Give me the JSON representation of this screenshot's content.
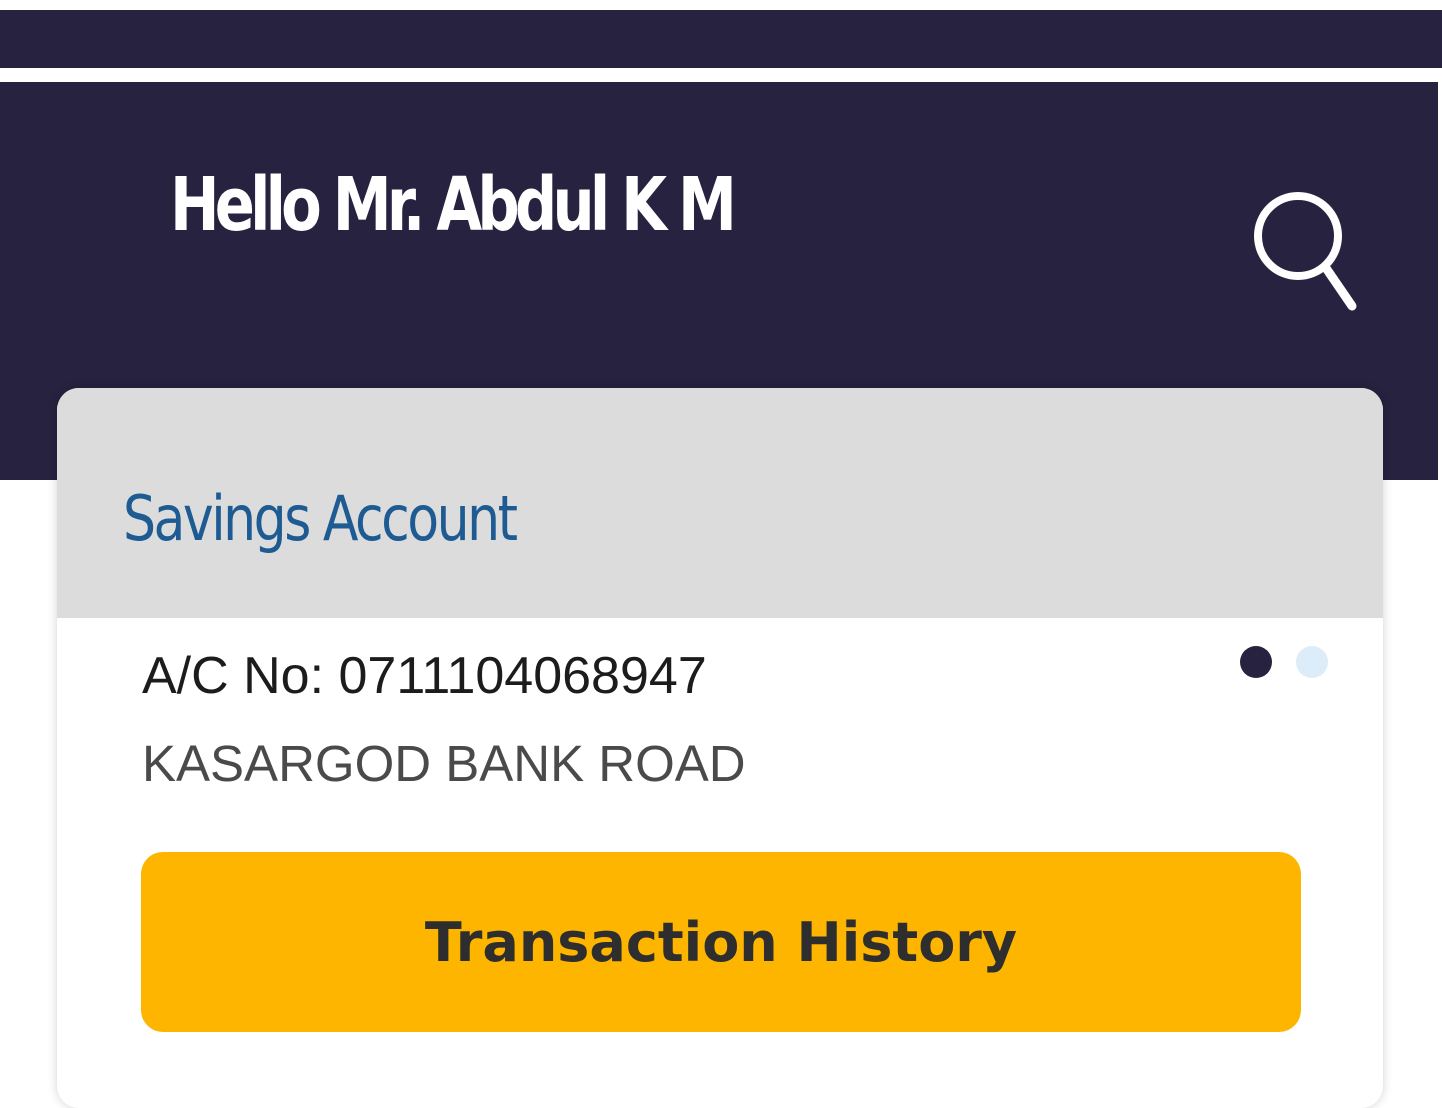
{
  "header": {
    "greeting": "Hello Mr. Abdul K M",
    "search_icon": "search-icon"
  },
  "account_card": {
    "title": "Savings Account",
    "account_number": "A/C No: 0711104068947",
    "branch": "KASARGOD BANK ROAD",
    "carousel": {
      "pages": 2,
      "active_page": 1
    },
    "transaction_button_label": "Transaction History"
  },
  "colors": {
    "header_bg": "#26223f",
    "card_head_bg": "#dcdcdc",
    "title_color": "#1d5b92",
    "button_bg": "#fdb500",
    "dot_active": "#26223f",
    "dot_inactive": "#dcecf8"
  }
}
